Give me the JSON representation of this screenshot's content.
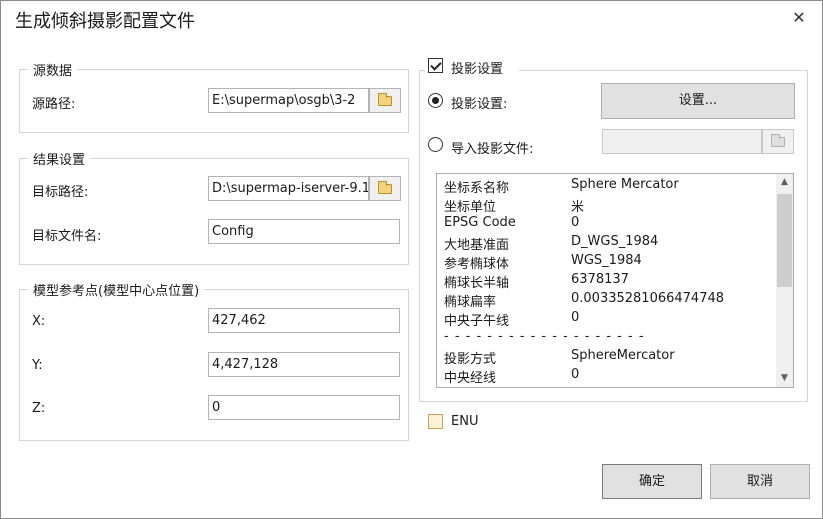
{
  "window": {
    "title": "生成倾斜摄影配置文件",
    "close_glyph": "✕"
  },
  "source": {
    "legend": "源数据",
    "path_label": "源路径:",
    "path_value": "E:\\supermap\\osgb\\3-2"
  },
  "result": {
    "legend": "结果设置",
    "target_path_label": "目标路径:",
    "target_path_value": "D:\\supermap-iserver-9.1.",
    "target_file_label": "目标文件名:",
    "target_file_value": "Config"
  },
  "reference_point": {
    "legend": "模型参考点(模型中心点位置)",
    "x_label": "X:",
    "x_value": "427,462",
    "y_label": "Y:",
    "y_value": "4,427,128",
    "z_label": "Z:",
    "z_value": "0"
  },
  "projection": {
    "enable_label": "投影设置",
    "enabled": true,
    "set_radio_label": "投影设置:",
    "set_button_label": "设置...",
    "import_radio_label": "导入投影文件:",
    "import_path_value": "",
    "info_rows": [
      {
        "key": "坐标系名称",
        "value": "Sphere Mercator"
      },
      {
        "key": "坐标单位",
        "value": "米"
      },
      {
        "key": "EPSG Code",
        "value": "0"
      },
      {
        "key": "大地基准面",
        "value": "D_WGS_1984"
      },
      {
        "key": "参考椭球体",
        "value": "WGS_1984"
      },
      {
        "key": "椭球长半轴",
        "value": "6378137"
      },
      {
        "key": "椭球扁率",
        "value": "0.00335281066474748"
      },
      {
        "key": "中央子午线",
        "value": "0"
      }
    ],
    "separator": "- - - - - - - - - - - - - - - - - - -",
    "info_rows_2": [
      {
        "key": "投影方式",
        "value": "SphereMercator"
      },
      {
        "key": "中央经线",
        "value": "0"
      }
    ]
  },
  "enu": {
    "label": "ENU",
    "checked": false
  },
  "buttons": {
    "ok": "确定",
    "cancel": "取消"
  },
  "icons": {
    "browse": "folder-icon",
    "scroll_up": "▲",
    "scroll_down": "▼"
  }
}
